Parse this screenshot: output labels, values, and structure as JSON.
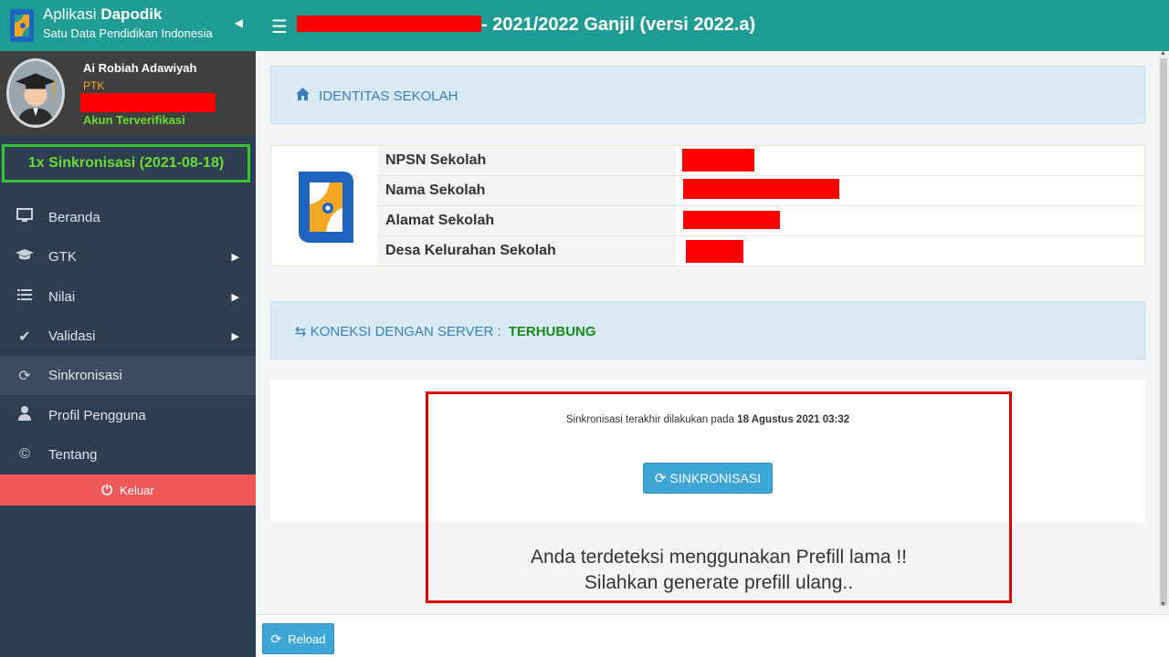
{
  "app": {
    "name_light": "Aplikasi",
    "name_bold": "Dapodik",
    "tagline": "Satu Data Pendidikan Indonesia",
    "collapse_icon": "caret-left-icon"
  },
  "user": {
    "name": "Ai Robiah Adawiyah",
    "role": "PTK",
    "status": "Akun Terverifikasi"
  },
  "sync_badge": "1x Sinkronisasi (2021-08-18)",
  "menu": [
    {
      "label": "Beranda",
      "icon": "monitor-icon",
      "has_sub": false,
      "active": false
    },
    {
      "label": "GTK",
      "icon": "graduation-cap-icon",
      "has_sub": true,
      "active": false
    },
    {
      "label": "Nilai",
      "icon": "list-icon",
      "has_sub": true,
      "active": false
    },
    {
      "label": "Validasi",
      "icon": "check-icon",
      "has_sub": true,
      "active": false
    },
    {
      "label": "Sinkronisasi",
      "icon": "refresh-icon",
      "has_sub": false,
      "active": true
    },
    {
      "label": "Profil Pengguna",
      "icon": "user-icon",
      "has_sub": false,
      "active": false
    },
    {
      "label": "Tentang",
      "icon": "copyright-icon",
      "has_sub": false,
      "active": false
    }
  ],
  "logout_label": "Keluar",
  "topbar": {
    "title": "- 2021/2022 Ganjil (versi 2022.a)"
  },
  "identity": {
    "title": "IDENTITAS SEKOLAH",
    "rows": [
      {
        "label": "NPSN Sekolah"
      },
      {
        "label": "Nama Sekolah"
      },
      {
        "label": "Alamat Sekolah"
      },
      {
        "label": "Desa Kelurahan Sekolah"
      }
    ]
  },
  "connection": {
    "label": "KONEKSI DENGAN SERVER :",
    "status": "TERHUBUNG"
  },
  "sync": {
    "text_prefix": "Sinkronisasi terakhir dilakukan pada",
    "last_sync": "18 Agustus 2021 03:32",
    "button_label": "SINKRONISASI"
  },
  "warning": {
    "line1": "Anda terdeteksi menggunakan Prefill lama !!",
    "line2": "Silahkan generate prefill ulang.."
  },
  "footer": {
    "reload_label": "Reload"
  },
  "colors": {
    "teal": "#1f9d94",
    "sidebar": "#2c3e50",
    "logout": "#ee5858",
    "accent_blue": "#3ea6d4",
    "redaction": "#ff0000"
  }
}
